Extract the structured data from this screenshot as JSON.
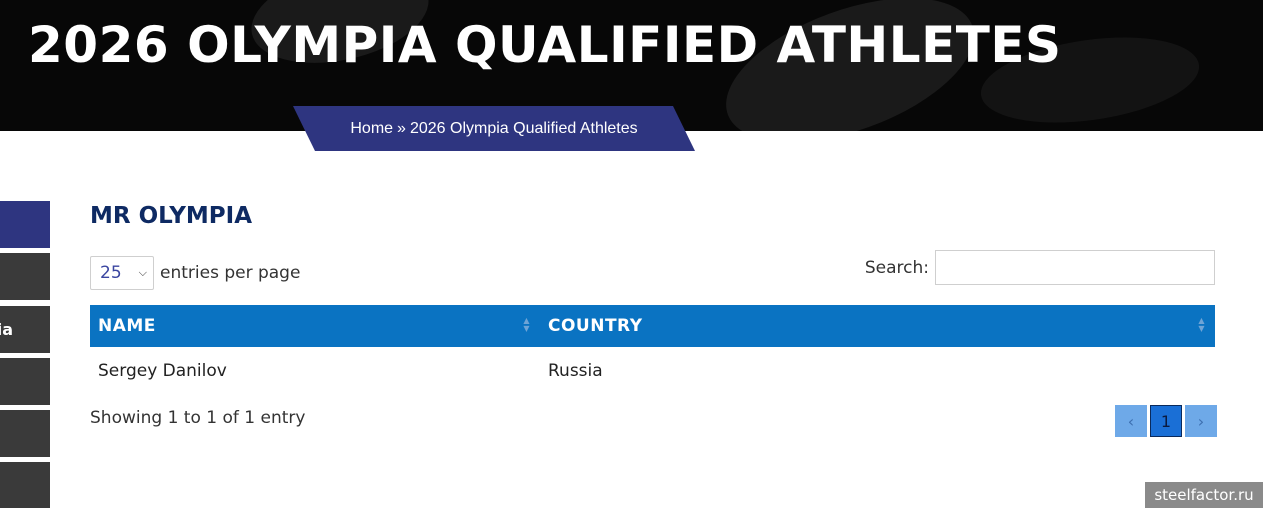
{
  "header": {
    "title": "2026 OLYMPIA QUALIFIED ATHLETES",
    "breadcrumb": {
      "home": "Home",
      "separator": "»",
      "current": "2026 Olympia Qualified Athletes"
    }
  },
  "sidebar": {
    "tabs": [
      {
        "label": "",
        "active": true
      },
      {
        "label": "",
        "active": false
      },
      {
        "label": "ia",
        "active": false
      },
      {
        "label": "",
        "active": false
      },
      {
        "label": "",
        "active": false
      },
      {
        "label": "",
        "active": false
      }
    ]
  },
  "section": {
    "title": "MR OLYMPIA"
  },
  "table_controls": {
    "length_value": "25",
    "length_suffix": "entries per page",
    "search_label": "Search:",
    "search_value": ""
  },
  "table": {
    "columns": [
      "NAME",
      "COUNTRY"
    ],
    "rows": [
      [
        "Sergey Danilov",
        "Russia"
      ]
    ]
  },
  "footer": {
    "info": "Showing 1 to 1 of 1 entry",
    "pagination": {
      "prev": "‹",
      "pages": [
        "1"
      ],
      "next": "›"
    }
  },
  "watermark": "steelfactor.ru",
  "colors": {
    "banner_bg": "#070707",
    "accent_navy": "#2e3580",
    "table_header": "#0a73c2",
    "title_navy": "#0e2a63"
  }
}
